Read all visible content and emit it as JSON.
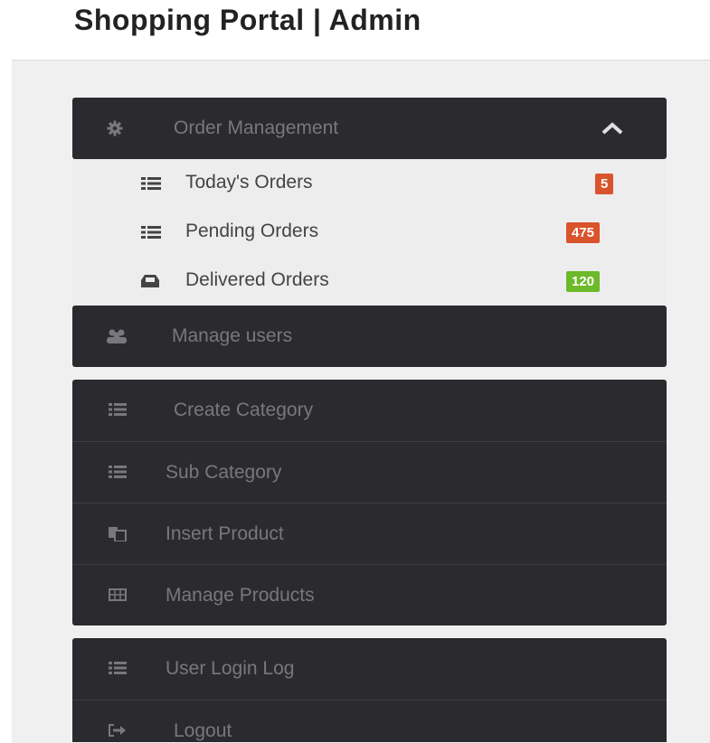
{
  "header": {
    "title": "Shopping Portal | Admin"
  },
  "sidebar": {
    "order_management": {
      "label": "Order Management",
      "submenu": [
        {
          "label": "Today's Orders",
          "badge": "5",
          "badge_color": "#d9532c"
        },
        {
          "label": "Pending Orders",
          "badge": "475",
          "badge_color": "#d9532c"
        },
        {
          "label": "Delivered Orders",
          "badge": "120",
          "badge_color": "#6cb92a"
        }
      ]
    },
    "manage_users": {
      "label": "Manage users"
    },
    "catalog": [
      {
        "label": "Create Category",
        "icon": "list-icon"
      },
      {
        "label": "Sub Category",
        "icon": "list-icon"
      },
      {
        "label": "Insert Product",
        "icon": "copy-icon"
      },
      {
        "label": "Manage Products",
        "icon": "table-icon"
      }
    ],
    "account": [
      {
        "label": "User Login Log",
        "icon": "list-icon"
      },
      {
        "label": "Logout",
        "icon": "sign-out-icon"
      }
    ]
  },
  "colors": {
    "panel_bg": "#2b2b2f",
    "menu_text": "#77777d",
    "badge_orange": "#d9532c",
    "badge_green": "#6cb92a"
  }
}
